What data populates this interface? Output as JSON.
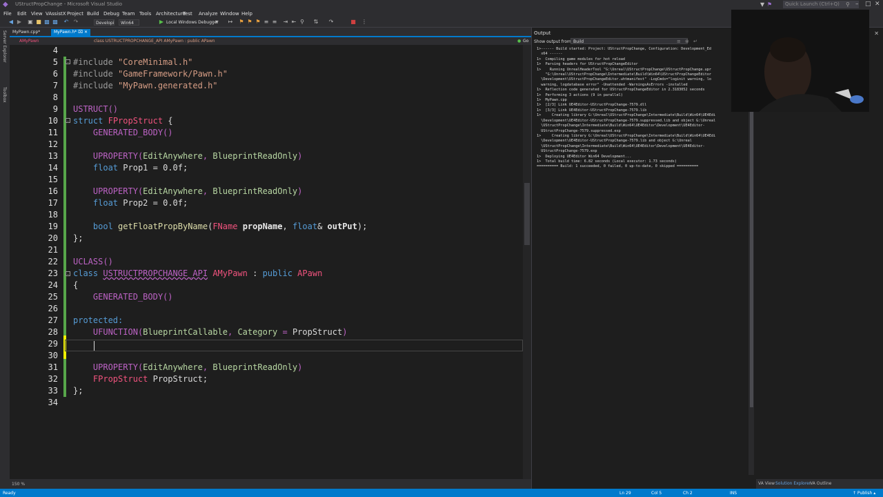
{
  "titlebar": {
    "title": "UStructPropChange - Microsoft Visual Studio",
    "quick_launch": "Quick Launch (Ctrl+Q)"
  },
  "menu": [
    "File",
    "Edit",
    "View",
    "VAssistX",
    "Project",
    "Build",
    "Debug",
    "Team",
    "Tools",
    "Architecture",
    "Test",
    "Analyze",
    "Window",
    "Help"
  ],
  "toolbar": {
    "config": "Developi",
    "platform": "Win64",
    "debugger": "Local Windows Debugger"
  },
  "left_strip": [
    "Server Explorer",
    "Toolbox"
  ],
  "tabs": [
    {
      "label": "MyPawn.cpp*",
      "active": false
    },
    {
      "label": "MyPawn.h*",
      "active": true
    }
  ],
  "nav": {
    "project": "AMyPawn",
    "scope": "class USTRUCTPROPCHANGE_API AMyPawn : public APawn",
    "go": "Go"
  },
  "code": {
    "line_numbers": [
      "4",
      "5",
      "6",
      "7",
      "8",
      "9",
      "10",
      "11",
      "12",
      "13",
      "14",
      "15",
      "16",
      "17",
      "18",
      "19",
      "20",
      "21",
      "22",
      "23",
      "24",
      "25",
      "26",
      "27",
      "28",
      "29",
      "30",
      "31",
      "32",
      "33",
      "34"
    ],
    "l5": {
      "pp": "#include",
      "s": "\"CoreMinimal.h\""
    },
    "l6": {
      "pp": "#include",
      "s": "\"GameFramework/Pawn.h\""
    },
    "l7": {
      "pp": "#include",
      "s": "\"MyPawn.generated.h\""
    },
    "l9": "USTRUCT()",
    "l10": {
      "kw": "struct",
      "name": "FPropStruct",
      "rest": " {"
    },
    "l11": "GENERATED_BODY()",
    "l13": {
      "mac": "UPROPERTY",
      "a": "EditAnywhere",
      "b": "BlueprintReadOnly"
    },
    "l14": {
      "kw": "float",
      "name": "Prop1",
      "rest": " = 0.0f;"
    },
    "l16": {
      "mac": "UPROPERTY",
      "a": "EditAnywhere",
      "b": "BlueprintReadOnly"
    },
    "l17": {
      "kw": "float",
      "name": "Prop2",
      "rest": " = 0.0f;"
    },
    "l19": {
      "kw": "bool",
      "fn": "getFloatPropByName",
      "t1": "FName",
      "p1": "propName",
      "t2": "float",
      "p2": "outPut"
    },
    "l20": "};",
    "l22": "UCLASS()",
    "l23": {
      "kw": "class",
      "api": "USTRUCTPROPCHANGE_API",
      "name": "AMyPawn",
      "colon": " : ",
      "pub": "public",
      "base": "APawn"
    },
    "l24": "{",
    "l25": "GENERATED_BODY()",
    "l27": "protected:",
    "l28": {
      "mac": "UFUNCTION",
      "a": "BlueprintCallable",
      "b": "Category",
      "eq": " = ",
      "c": "PropStruct"
    },
    "l31": {
      "mac": "UPROPERTY",
      "a": "EditAnywhere",
      "b": "BlueprintReadOnly"
    },
    "l32": {
      "type": "FPropStruct",
      "name": "PropStruct",
      "rest": ";"
    },
    "l33": "};"
  },
  "zoom": "150 %",
  "output": {
    "header": "Output",
    "show_from_label": "Show output from:",
    "show_from_value": "Build",
    "text": "1>------ Build started: Project: UStructPropChange, Configuration: Development_Ed\n  x64 ------\n1>  Compiling game modules for hot reload\n1>  Parsing headers for UStructPropChangeEditor\n1>    Running UnrealHeaderTool \"G:\\Unreal\\UStructPropChange\\UStructPropChange.upr\n    \"G:\\Unreal\\UStructPropChange\\Intermediate\\Build\\Win64\\UStructPropChangeEditor\n  \\Development\\UStructPropChangeEditor.uhtmanifest\" -LogCmds=\"loginit warning, lo\n  warning, logdatabase error\" -Unattended -WarningsAsErrors -installed\n1>  Reflection code generated for UStructPropChangeEditor in 2.3183052 seconds\n1>  Performing 3 actions (9 in parallel)\n1>  MyPawn.cpp\n1>  [2/3] Link UE4Editor-UStructPropChange-7579.dll\n1>  [3/3] Link UE4Editor-UStructPropChange-7579.lib\n1>     Creating library G:\\Unreal\\UStructPropChange\\Intermediate\\Build\\Win64\\UE4Edi\n  \\Development\\UE4Editor-UStructPropChange-7579.suppressed.lib and object G:\\Unreal\n  \\UStructPropChange\\Intermediate\\Build\\Win64\\UE4Editor\\Development\\UE4Editor-\n  UStructPropChange-7579.suppressed.exp\n1>     Creating library G:\\Unreal\\UStructPropChange\\Intermediate\\Build\\Win64\\UE4Edi\n  \\Development\\UE4Editor-UStructPropChange-7579.lib and object G:\\Unreal\n  \\UStructPropChange\\Intermediate\\Build\\Win64\\UE4Editor\\Development\\UE4Editor-\n  UStructPropChange-7579.exp\n1>  Deploying UE4Editor Win64 Development...\n1>  Total build time: 6.82 seconds (Local executor: 1.73 seconds)\n========== Build: 1 succeeded, 0 failed, 0 up-to-date, 0 skipped =========="
  },
  "bottom_tabs": [
    "VA View",
    "Solution Explorer",
    "VA Outline"
  ],
  "status": {
    "ready": "Ready",
    "ln": "Ln 29",
    "col": "Col 5",
    "ch": "Ch 2",
    "ins": "INS",
    "publish": "↑ Publish ▴"
  },
  "colors": {
    "accent": "#007acc",
    "editor_bg": "#1e1e1e",
    "keyword": "#569cd6",
    "macro": "#bd63c5",
    "class_name": "#f1537e",
    "change_bar": "#57a64a"
  }
}
